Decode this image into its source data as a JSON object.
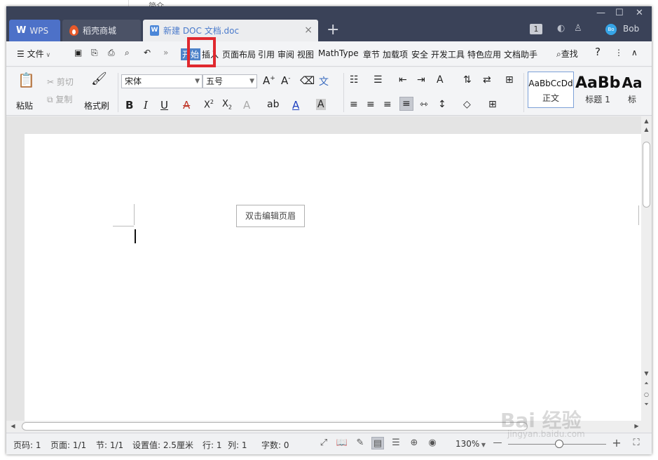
{
  "background": {
    "fragment": "简介"
  },
  "window": {
    "tabs": [
      {
        "label": "WPS",
        "logo": "W"
      },
      {
        "label": "稻壳商城"
      },
      {
        "label": "新建 DOC 文档.doc",
        "close": "×"
      }
    ],
    "new_tab": "+",
    "controls": {
      "min": "—",
      "max": "☐",
      "close": "✕"
    },
    "badge": "1",
    "user": {
      "avatar": "Bo",
      "name": "Bob"
    }
  },
  "menu": {
    "file_label": "文件",
    "tabs": [
      "开始",
      "插入",
      "页面布局",
      "引用",
      "审阅",
      "视图",
      "MathType",
      "章节",
      "加载项",
      "安全",
      "开发工具",
      "特色应用",
      "文档助手"
    ],
    "active_tab": "开始",
    "highlighted_tab": "插入",
    "search_label": "查找",
    "help": "?",
    "more": "⋮",
    "collapse": "∧"
  },
  "ribbon": {
    "paste": "粘贴",
    "cut": "剪切",
    "copy": "复制",
    "format_painter": "格式刷",
    "font_name": "宋体",
    "font_size": "五号",
    "bold": "B",
    "italic": "I",
    "underline": "U",
    "styles": [
      {
        "sample": "AaBbCcDd",
        "name": "正文"
      },
      {
        "sample": "AaBb",
        "name": "标题 1"
      },
      {
        "sample": "Aa",
        "name": "标"
      }
    ]
  },
  "document": {
    "header_hint": "双击编辑页眉"
  },
  "status": {
    "page_num": "页码: 1",
    "pages": "页面: 1/1",
    "section": "节: 1/1",
    "setting": "设置值: 2.5厘米",
    "row": "行: 1",
    "col": "列: 1",
    "words": "字数: 0",
    "zoom": "130%"
  },
  "watermark": {
    "main": "Bai 经验",
    "sub": "jingyan.baidu.com"
  },
  "colors": {
    "accent": "#4d82c9",
    "highlight": "#e0282e",
    "titlebar": "#3a4258"
  }
}
